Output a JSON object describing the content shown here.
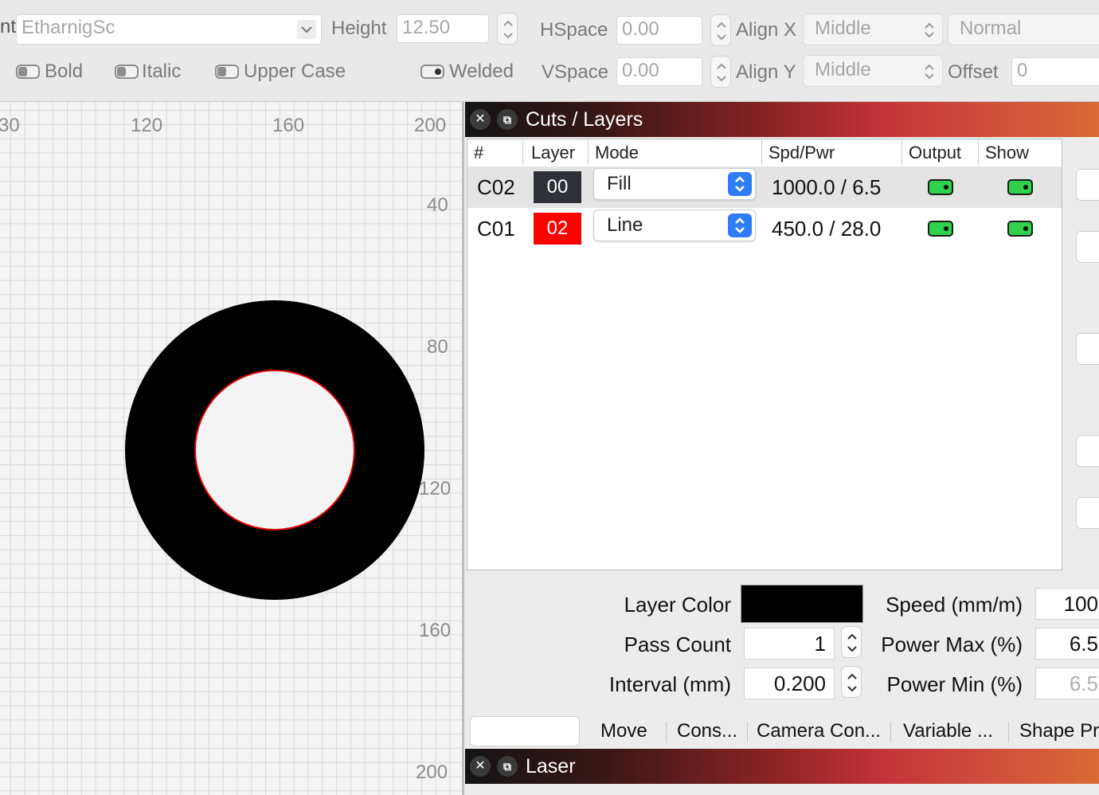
{
  "toolbar": {
    "font_label": "nt",
    "font_value": "EtharnigSc",
    "height_label": "Height",
    "height_value": "12.50",
    "hspace_label": "HSpace",
    "hspace_value": "0.00",
    "vspace_label": "VSpace",
    "vspace_value": "0.00",
    "alignx_label": "Align X",
    "alignx_value": "Middle",
    "aligny_label": "Align Y",
    "aligny_value": "Middle",
    "normal_value": "Normal",
    "offset_label": "Offset",
    "offset_value": "0",
    "bold_label": "Bold",
    "italic_label": "Italic",
    "uppercase_label": "Upper Case",
    "welded_label": "Welded"
  },
  "canvas": {
    "ruler_x": [
      "30",
      "120",
      "160",
      "200"
    ],
    "ruler_y": [
      "40",
      "80",
      "120",
      "160",
      "200"
    ]
  },
  "cuts_panel": {
    "title": "Cuts / Layers",
    "columns": [
      "#",
      "Layer",
      "Mode",
      "Spd/Pwr",
      "Output",
      "Show"
    ],
    "rows": [
      {
        "num": "C02",
        "layer": "00",
        "layer_color": "#2e3238",
        "mode": "Fill",
        "spdpwr": "1000.0 / 6.5",
        "output": true,
        "show": true
      },
      {
        "num": "C01",
        "layer": "02",
        "layer_color": "#ff0000",
        "mode": "Line",
        "spdpwr": "450.0 / 28.0",
        "output": true,
        "show": true
      }
    ],
    "props": {
      "layer_color_label": "Layer Color",
      "layer_color_value": "#000000",
      "pass_count_label": "Pass Count",
      "pass_count_value": "1",
      "interval_label": "Interval (mm)",
      "interval_value": "0.200",
      "speed_label": "Speed (mm/m)",
      "speed_value": "100",
      "power_max_label": "Power Max (%)",
      "power_max_value": "6.5",
      "power_min_label": "Power Min (%)",
      "power_min_value": "6.5"
    }
  },
  "bottom_tabs": [
    "Move",
    "Cons...",
    "Camera Con...",
    "Variable ...",
    "Shape Pr"
  ],
  "laser_panel": {
    "title": "Laser"
  },
  "colors": {
    "toggle_green": "#2fd24a",
    "accent_blue": "#2f7cf6"
  }
}
